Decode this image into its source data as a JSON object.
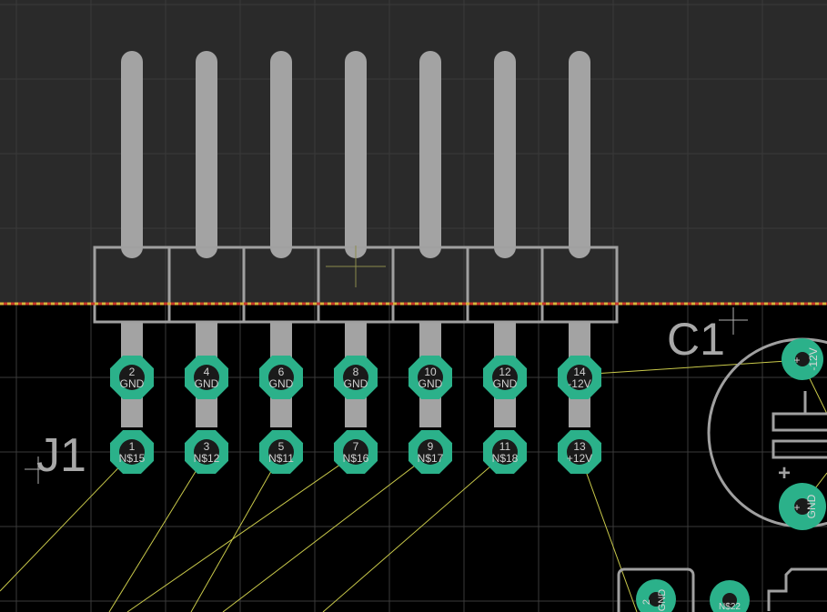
{
  "colors": {
    "board_background": "#000000",
    "outside_background": "#2a2a2a",
    "grid": "#3c3c3c",
    "silkscreen": "#a0a0a0",
    "pin_body": "#a3a3a3",
    "pad_copper": "#2bb18a",
    "pad_hole": "#1a1a1a",
    "pad_text": "#d6d6d6",
    "ratsnest": "#c9c94a",
    "board_edge_red": "#c8382a",
    "board_edge_yellow": "#d6b23a"
  },
  "components": {
    "j1": {
      "designator": "J1",
      "pads_top": [
        {
          "number": "2",
          "net": "GND"
        },
        {
          "number": "4",
          "net": "GND"
        },
        {
          "number": "6",
          "net": "GND"
        },
        {
          "number": "8",
          "net": "GND"
        },
        {
          "number": "10",
          "net": "GND"
        },
        {
          "number": "12",
          "net": "GND"
        },
        {
          "number": "14",
          "net": "-12V"
        }
      ],
      "pads_bottom": [
        {
          "number": "1",
          "net": "N$15"
        },
        {
          "number": "3",
          "net": "N$12"
        },
        {
          "number": "5",
          "net": "N$11"
        },
        {
          "number": "7",
          "net": "N$16"
        },
        {
          "number": "9",
          "net": "N$17"
        },
        {
          "number": "11",
          "net": "N$18"
        },
        {
          "number": "13",
          "net": "+12V"
        }
      ]
    },
    "c1": {
      "designator": "C1",
      "pad_top_net": "-12V",
      "pad_top_mark": "+",
      "pad_bottom_net": "GND",
      "pad_bottom_mark": "+",
      "polarity_mark": "+"
    },
    "bottom_parts": {
      "left_pad_net": "GND",
      "left_pad_number": "2",
      "right_pad_net": "N$22"
    }
  },
  "icons": {
    "origin_cross": "crosshair-icon",
    "cursor_cross": "crosshair-icon"
  }
}
